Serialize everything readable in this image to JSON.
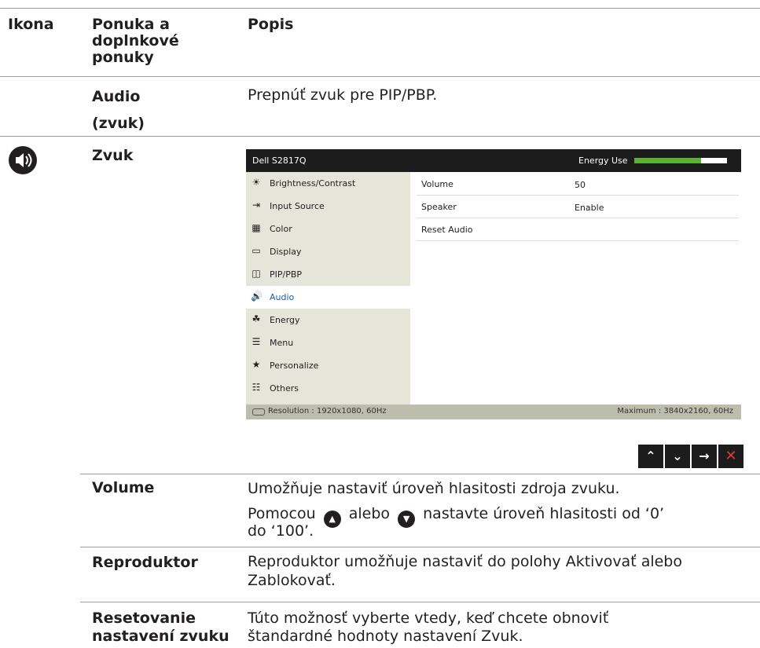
{
  "header": {
    "col_icon": "Ikona",
    "col_menu": "Ponuka a doplnkové ponuky",
    "col_desc": "Popis"
  },
  "audio_row": {
    "label": "Audio (zvuk)",
    "desc": "Prepnúť zvuk pre PIP/PBP."
  },
  "zvuk_row": {
    "label": "Zvuk",
    "icon": "speaker-icon"
  },
  "osd": {
    "title": "Dell S2817Q",
    "energy_label": "Energy Use",
    "energy_level": 0.72,
    "menu": [
      {
        "label": "Brightness/Contrast",
        "icon": "brightness-icon"
      },
      {
        "label": "Input Source",
        "icon": "input-source-icon"
      },
      {
        "label": "Color",
        "icon": "color-icon"
      },
      {
        "label": "Display",
        "icon": "display-icon"
      },
      {
        "label": "PIP/PBP",
        "icon": "pip-icon"
      },
      {
        "label": "Audio",
        "icon": "audio-icon",
        "selected": true
      },
      {
        "label": "Energy",
        "icon": "energy-icon"
      },
      {
        "label": "Menu",
        "icon": "menu-icon"
      },
      {
        "label": "Personalize",
        "icon": "star-icon"
      },
      {
        "label": "Others",
        "icon": "others-icon"
      }
    ],
    "settings": [
      {
        "label": "Volume",
        "value": "50"
      },
      {
        "label": "Speaker",
        "value": "Enable"
      },
      {
        "label": "Reset Audio",
        "value": ""
      }
    ],
    "resolution": "Resolution : 1920x1080, 60Hz",
    "maximum": "Maximum : 3840x2160, 60Hz",
    "accent": "#1a5bb8",
    "energy_color": "#59b233"
  },
  "nav_buttons": [
    "up",
    "down",
    "enter",
    "exit"
  ],
  "rows": [
    {
      "label": "Volume",
      "desc_line1": "Umožňuje nastaviť úroveň hlasitosti zdroja zvuku.",
      "desc_pre": "Pomocou",
      "desc_mid": "alebo",
      "desc_post": "nastavte úroveň hlasitosti od ‘0’",
      "desc_line3": "do ‘100’."
    },
    {
      "label": "Reproduktor",
      "desc_line1": "Reproduktor umožňuje nastaviť do polohy Aktivovať alebo",
      "desc_line2": "Zablokovať."
    },
    {
      "label_line1": "Resetovanie",
      "label_line2": "nastavení zvuku",
      "desc_line1": "Túto možnosť vyberte vtedy, keď chcete obnoviť",
      "desc_line2": "štandardné hodnoty nastavení Zvuk."
    }
  ]
}
